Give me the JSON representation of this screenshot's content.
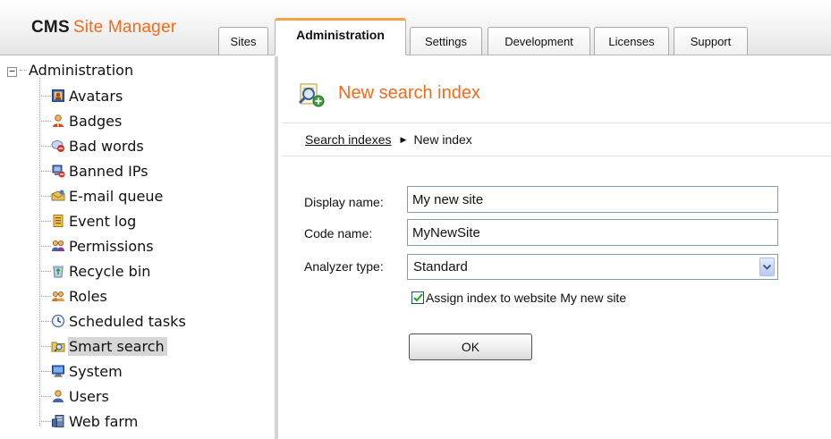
{
  "app": {
    "logo_bold": "CMS",
    "logo_rest": "Site Manager",
    "brand_color": "#f26b1d",
    "active_tab_accent": "#f7a24a"
  },
  "tabs": [
    {
      "label": "Sites",
      "active": false
    },
    {
      "label": "Administration",
      "active": true
    },
    {
      "label": "Settings",
      "active": false
    },
    {
      "label": "Development",
      "active": false
    },
    {
      "label": "Licenses",
      "active": false
    },
    {
      "label": "Support",
      "active": false
    }
  ],
  "tree": {
    "root": {
      "label": "Administration",
      "expanded": true
    },
    "items": [
      {
        "label": "Avatars",
        "icon": "avatar-icon",
        "selected": false
      },
      {
        "label": "Badges",
        "icon": "badge-icon",
        "selected": false
      },
      {
        "label": "Bad words",
        "icon": "bad-words-icon",
        "selected": false
      },
      {
        "label": "Banned IPs",
        "icon": "banned-ip-icon",
        "selected": false
      },
      {
        "label": "E-mail queue",
        "icon": "email-queue-icon",
        "selected": false
      },
      {
        "label": "Event log",
        "icon": "event-log-icon",
        "selected": false
      },
      {
        "label": "Permissions",
        "icon": "permissions-icon",
        "selected": false
      },
      {
        "label": "Recycle bin",
        "icon": "recycle-bin-icon",
        "selected": false
      },
      {
        "label": "Roles",
        "icon": "roles-icon",
        "selected": false
      },
      {
        "label": "Scheduled tasks",
        "icon": "clock-icon",
        "selected": false
      },
      {
        "label": "Smart search",
        "icon": "smart-search-icon",
        "selected": true
      },
      {
        "label": "System",
        "icon": "computer-icon",
        "selected": false
      },
      {
        "label": "Users",
        "icon": "user-icon",
        "selected": false
      },
      {
        "label": "Web farm",
        "icon": "server-icon",
        "selected": false
      }
    ]
  },
  "main": {
    "page_title": "New search index",
    "page_icon": "search-index-add-icon",
    "breadcrumb": {
      "link": "Search indexes",
      "current": "New index"
    },
    "form": {
      "display_name_label": "Display name:",
      "display_name_value": "My new site",
      "code_name_label": "Code name:",
      "code_name_value": "MyNewSite",
      "analyzer_label": "Analyzer type:",
      "analyzer_value": "Standard",
      "assign_checked": true,
      "assign_label": "Assign index to website My new site",
      "ok_label": "OK"
    }
  }
}
